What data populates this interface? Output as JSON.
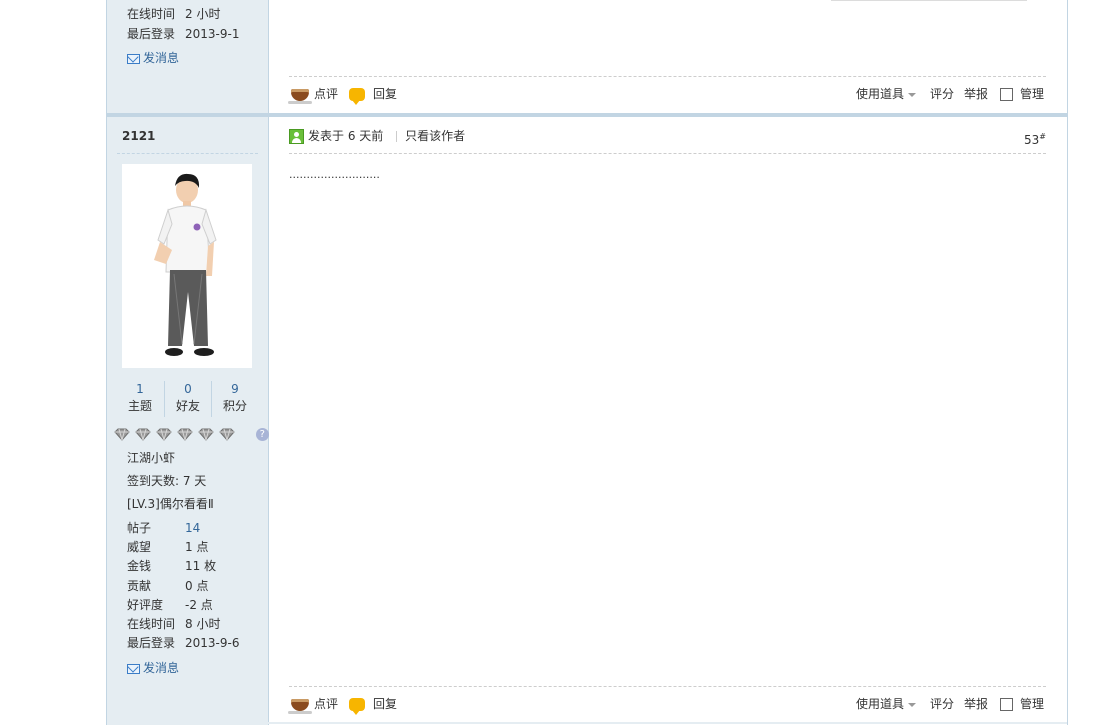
{
  "prev_post": {
    "user_info": [
      {
        "key": "在线时间",
        "value": "2 小时"
      },
      {
        "key": "最后登录",
        "value": "2013-9-1"
      }
    ],
    "send_message": "发消息",
    "actions": {
      "comment": "点评",
      "reply": "回复",
      "use_item": "使用道具",
      "rate": "评分",
      "report": "举报",
      "manage": "管理"
    }
  },
  "post": {
    "author": "2121",
    "meta": {
      "posted_at": "发表于 6 天前",
      "only_author": "只看该作者",
      "floor": "53",
      "floor_suffix": "#"
    },
    "content": "..........................",
    "stats": [
      {
        "num": "1",
        "label": "主题"
      },
      {
        "num": "0",
        "label": "好友"
      },
      {
        "num": "9",
        "label": "积分"
      }
    ],
    "help": "?",
    "rank_title": "江湖小虾",
    "checkin": "签到天数: 7 天",
    "level": "[LV.3]偶尔看看Ⅱ",
    "user_info": [
      {
        "key": "帖子",
        "value": "14"
      },
      {
        "key": "威望",
        "value": "1 点"
      },
      {
        "key": "金钱",
        "value": "11 枚"
      },
      {
        "key": "贡献",
        "value": "0 点"
      },
      {
        "key": "好评度",
        "value": "-2 点"
      },
      {
        "key": "在线时间",
        "value": "8 小时"
      },
      {
        "key": "最后登录",
        "value": "2013-9-6"
      }
    ],
    "send_message": "发消息",
    "actions": {
      "comment": "点评",
      "reply": "回复",
      "use_item": "使用道具",
      "rate": "评分",
      "report": "举报",
      "manage": "管理"
    }
  },
  "colors": {
    "sidebar_bg": "#e5edf2",
    "border": "#c2d5e3",
    "link": "#336699"
  }
}
